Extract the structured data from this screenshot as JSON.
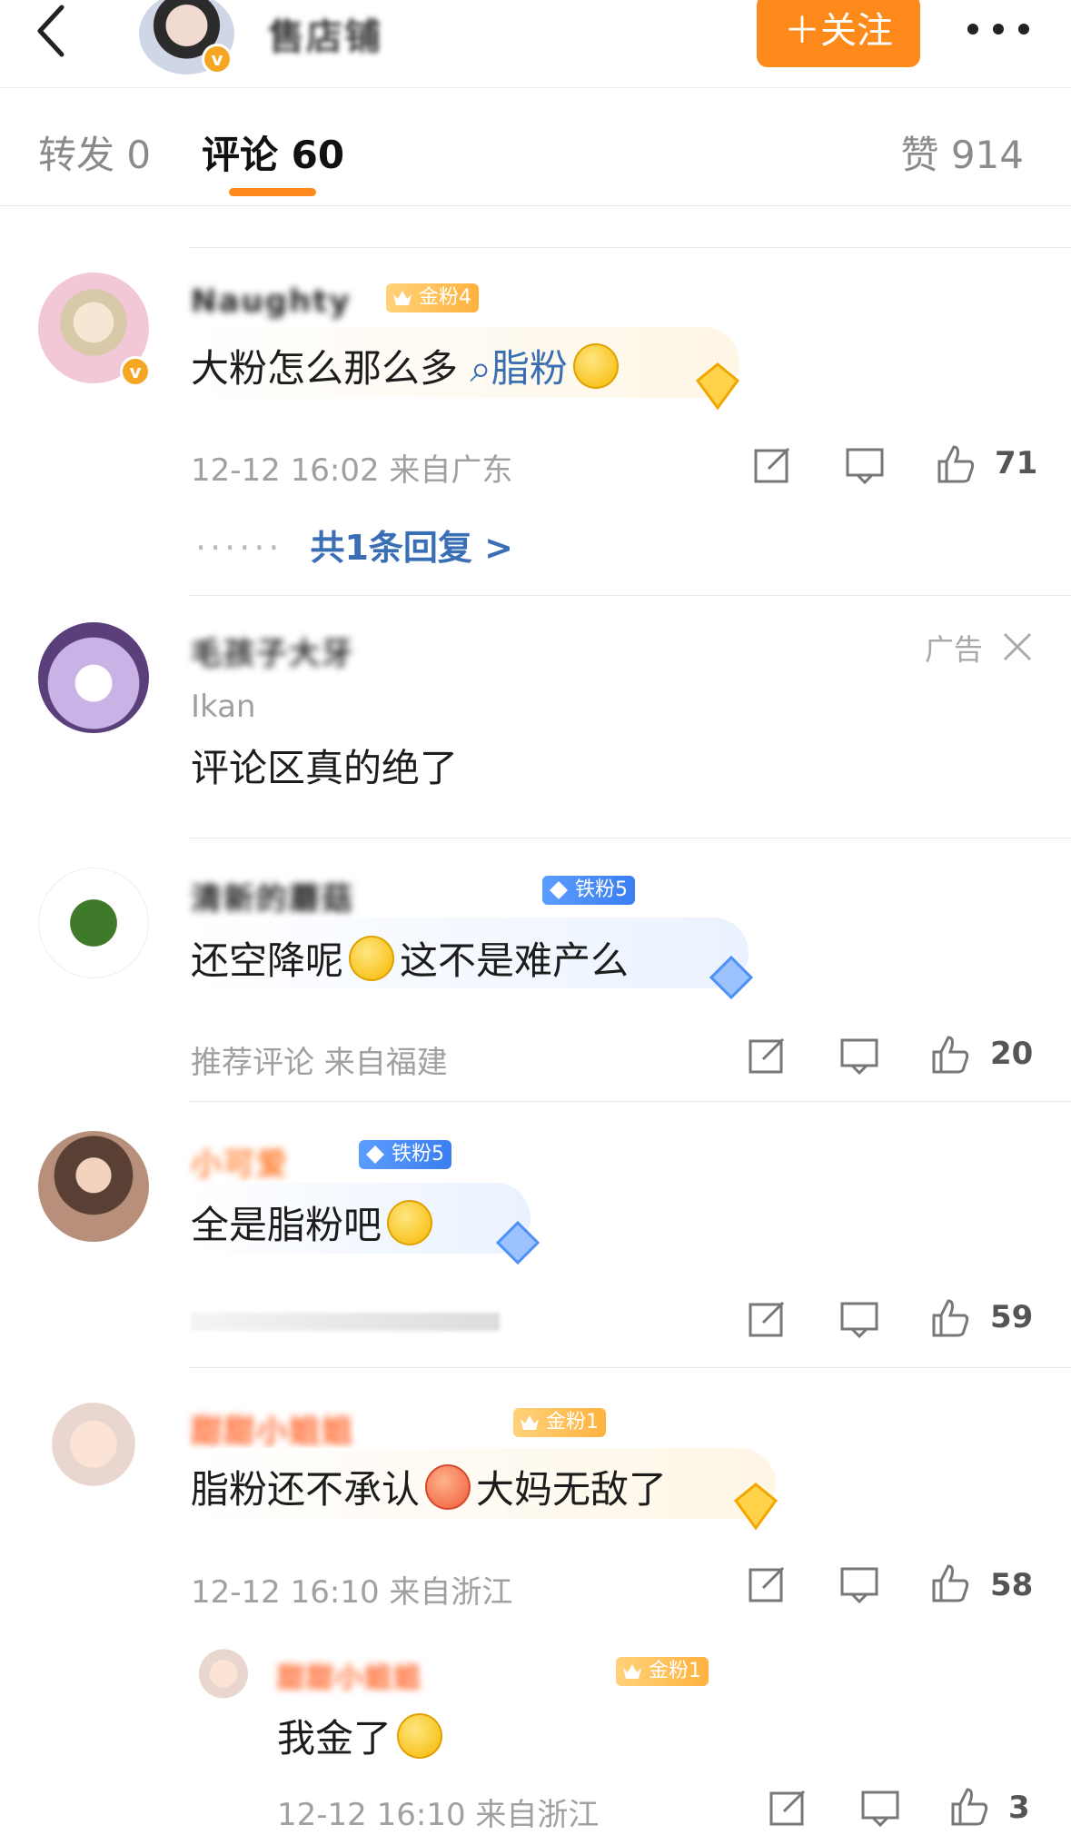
{
  "header": {
    "username": "售店铺",
    "follow_label": "＋关注"
  },
  "tabs": {
    "repost": "转发 0",
    "comment": "评论 60",
    "like": "赞 914"
  },
  "comments": [
    {
      "username": "Naughty",
      "fan_badge": "金粉4",
      "text_before": "大粉怎么那么多",
      "search_term": "脂粉",
      "meta": "12-12 16:02 来自广东",
      "likes": "71",
      "replies": "共1条回复 >"
    },
    {
      "username": "毛孩子大牙",
      "ad_label": "广告",
      "subtitle": "Ikan",
      "text": "评论区真的绝了"
    },
    {
      "username": "清新的蘑菇",
      "fan_badge": "铁粉5",
      "text_before": "还空降呢",
      "text_after": "这不是难产么",
      "meta": "推荐评论  来自福建",
      "likes": "20"
    },
    {
      "username": "小可爱",
      "fan_badge": "铁粉5",
      "text": "全是脂粉吧",
      "likes": "59"
    },
    {
      "username": "甜甜小姐姐",
      "fan_badge": "金粉1",
      "text_before": "脂粉还不承认",
      "text_after": "大妈无敌了",
      "meta": "12-12 16:10 来自浙江",
      "likes": "58"
    }
  ],
  "reply": {
    "username": "甜甜小姐姐",
    "fan_badge": "金粉1",
    "text": "我金了",
    "meta": "12-12 16:10 来自浙江",
    "likes": "3"
  },
  "colors": {
    "accent": "#ff8a1c",
    "link": "#3a6fb5",
    "iron_badge": "#4c8ff5",
    "gold_badge": "#f5a623"
  }
}
